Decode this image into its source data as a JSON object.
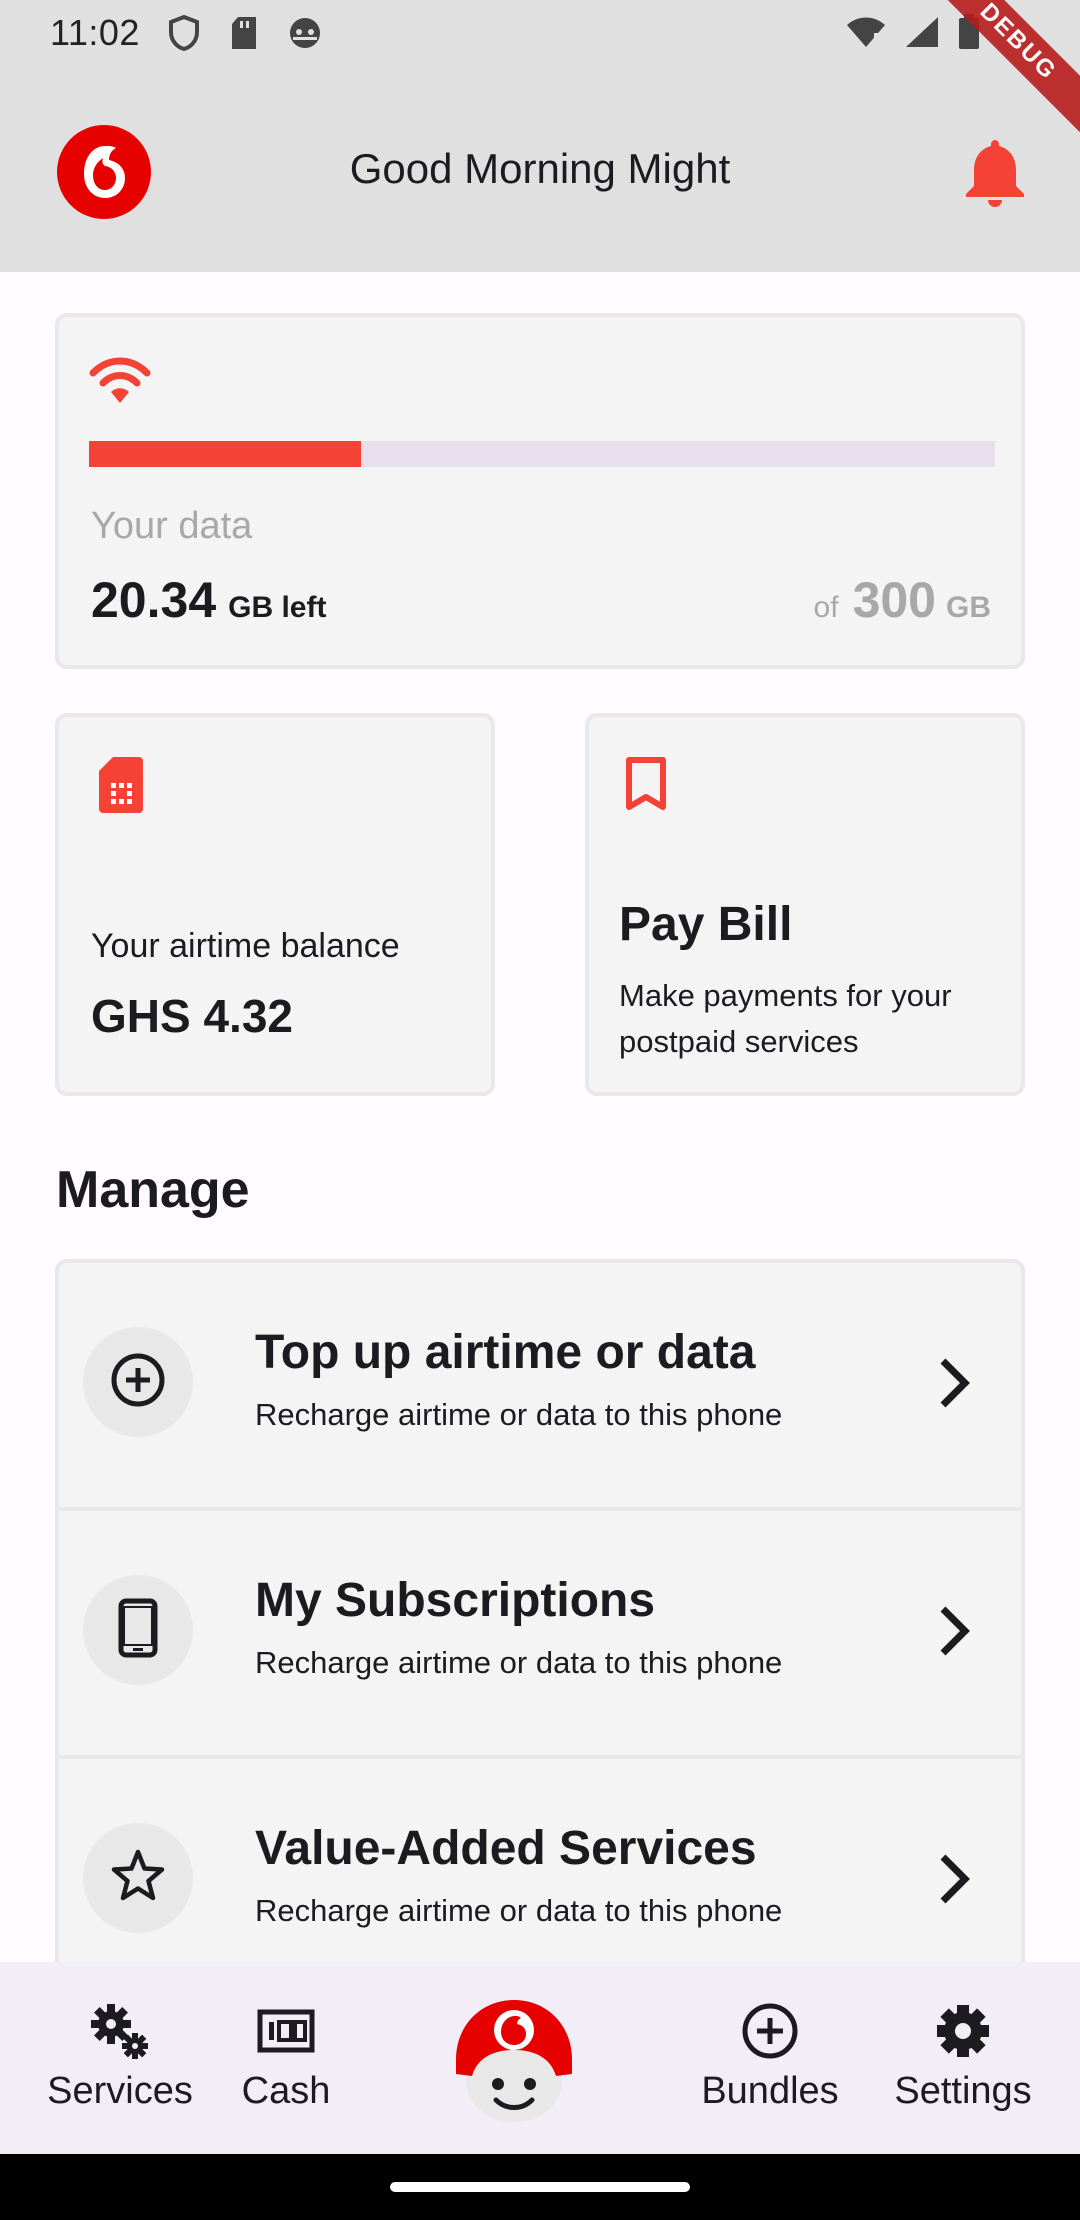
{
  "status_bar": {
    "time": "11:02",
    "icons": [
      "shield-icon",
      "sd-card-icon",
      "android-icon",
      "wifi-icon",
      "signal-icon",
      "battery-icon"
    ]
  },
  "debug_banner": "DEBUG",
  "app_bar": {
    "greeting": "Good Morning Might",
    "logo": "vodafone-logo",
    "notification_icon": "bell-icon"
  },
  "data_card": {
    "label": "Your data",
    "remaining": "20.34",
    "remaining_unit": "GB left",
    "of_label": "of",
    "total": "300",
    "total_unit": "GB",
    "usage_fraction": 0.3
  },
  "airtime_card": {
    "label": "Your airtime balance",
    "value": "GHS 4.32"
  },
  "paybill_card": {
    "title": "Pay Bill",
    "description": "Make payments for your postpaid services"
  },
  "manage": {
    "title": "Manage",
    "items": [
      {
        "title": "Top up airtime or data",
        "subtitle": "Recharge airtime or data to this phone",
        "icon": "add-circle-icon"
      },
      {
        "title": "My Subscriptions",
        "subtitle": "Recharge airtime or data to this phone",
        "icon": "phone-icon"
      },
      {
        "title": "Value-Added Services",
        "subtitle": "Recharge airtime or data to this phone",
        "icon": "star-icon"
      }
    ]
  },
  "bottom_nav": {
    "services": "Services",
    "cash": "Cash",
    "bundles": "Bundles",
    "settings": "Settings"
  },
  "colors": {
    "accent": "#f44336",
    "brand": "#e60000",
    "appbar_bg": "#e0e0e0",
    "nav_bg": "#f3edf7"
  }
}
